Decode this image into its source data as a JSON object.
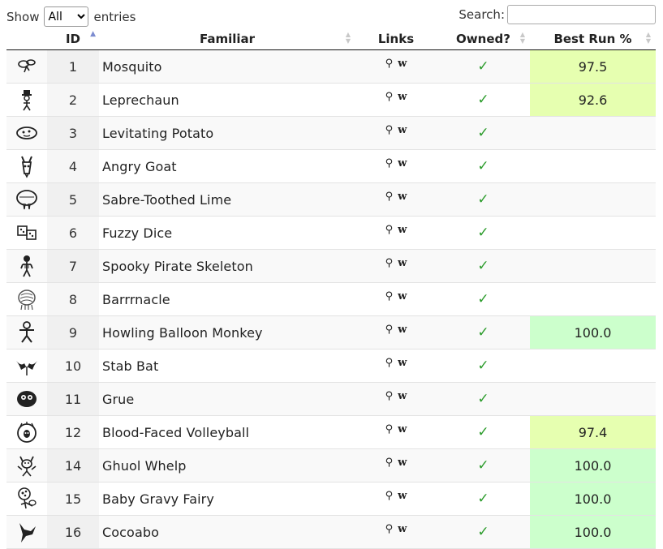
{
  "controls": {
    "show_label": "Show",
    "length_selected": "All",
    "entries_label": "entries",
    "search_label": "Search:",
    "search_value": ""
  },
  "columns": {
    "id": "ID",
    "familiar": "Familiar",
    "links": "Links",
    "owned": "Owned?",
    "best": "Best Run %"
  },
  "icons": {
    "links_search": "magnifier-icon",
    "links_wiki": "wiki-icon"
  },
  "colors": {
    "highlight_yellow": "#e6ffb0",
    "highlight_green": "#ccffcc",
    "check_green": "#2a9b2a",
    "sort_active": "#7c8cd0"
  },
  "rows": [
    {
      "icon": "mosquito-icon",
      "id": "1",
      "name": "Mosquito",
      "search_glyph": "⚲",
      "wiki_glyph": "w",
      "owned": "✓",
      "best": "97.5",
      "hl": "yellow"
    },
    {
      "icon": "leprechaun-icon",
      "id": "2",
      "name": "Leprechaun",
      "search_glyph": "⚲",
      "wiki_glyph": "w",
      "owned": "✓",
      "best": "92.6",
      "hl": "yellow"
    },
    {
      "icon": "levitating-potato-icon",
      "id": "3",
      "name": "Levitating Potato",
      "search_glyph": "⚲",
      "wiki_glyph": "w",
      "owned": "✓",
      "best": "",
      "hl": ""
    },
    {
      "icon": "angry-goat-icon",
      "id": "4",
      "name": "Angry Goat",
      "search_glyph": "⚲",
      "wiki_glyph": "w",
      "owned": "✓",
      "best": "",
      "hl": ""
    },
    {
      "icon": "sabre-toothed-lime-icon",
      "id": "5",
      "name": "Sabre-Toothed Lime",
      "search_glyph": "⚲",
      "wiki_glyph": "w",
      "owned": "✓",
      "best": "",
      "hl": ""
    },
    {
      "icon": "fuzzy-dice-icon",
      "id": "6",
      "name": "Fuzzy Dice",
      "search_glyph": "⚲",
      "wiki_glyph": "w",
      "owned": "✓",
      "best": "",
      "hl": ""
    },
    {
      "icon": "spooky-pirate-skeleton-icon",
      "id": "7",
      "name": "Spooky Pirate Skeleton",
      "search_glyph": "⚲",
      "wiki_glyph": "w",
      "owned": "✓",
      "best": "",
      "hl": ""
    },
    {
      "icon": "barrrnacle-icon",
      "id": "8",
      "name": "Barrrnacle",
      "search_glyph": "⚲",
      "wiki_glyph": "w",
      "owned": "✓",
      "best": "",
      "hl": ""
    },
    {
      "icon": "howling-balloon-monkey-icon",
      "id": "9",
      "name": "Howling Balloon Monkey",
      "search_glyph": "⚲",
      "wiki_glyph": "w",
      "owned": "✓",
      "best": "100.0",
      "hl": "green"
    },
    {
      "icon": "stab-bat-icon",
      "id": "10",
      "name": "Stab Bat",
      "search_glyph": "⚲",
      "wiki_glyph": "w",
      "owned": "✓",
      "best": "",
      "hl": ""
    },
    {
      "icon": "grue-icon",
      "id": "11",
      "name": "Grue",
      "search_glyph": "⚲",
      "wiki_glyph": "w",
      "owned": "✓",
      "best": "",
      "hl": ""
    },
    {
      "icon": "blood-faced-volleyball-icon",
      "id": "12",
      "name": "Blood-Faced Volleyball",
      "search_glyph": "⚲",
      "wiki_glyph": "w",
      "owned": "✓",
      "best": "97.4",
      "hl": "yellow"
    },
    {
      "icon": "ghuol-whelp-icon",
      "id": "14",
      "name": "Ghuol Whelp",
      "search_glyph": "⚲",
      "wiki_glyph": "w",
      "owned": "✓",
      "best": "100.0",
      "hl": "green"
    },
    {
      "icon": "baby-gravy-fairy-icon",
      "id": "15",
      "name": "Baby Gravy Fairy",
      "search_glyph": "⚲",
      "wiki_glyph": "w",
      "owned": "✓",
      "best": "100.0",
      "hl": "green"
    },
    {
      "icon": "cocoabo-icon",
      "id": "16",
      "name": "Cocoabo",
      "search_glyph": "⚲",
      "wiki_glyph": "w",
      "owned": "✓",
      "best": "100.0",
      "hl": "green"
    }
  ]
}
